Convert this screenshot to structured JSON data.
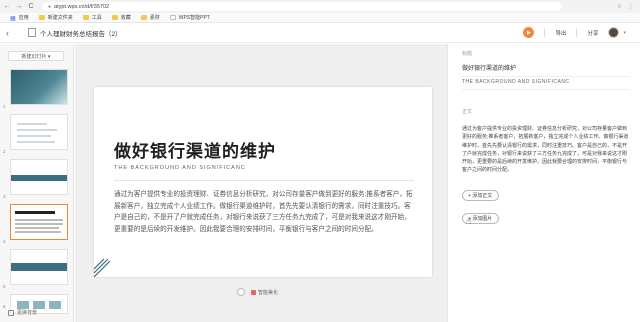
{
  "browser": {
    "url": "atypt.wps.cn/d/f/35702",
    "back": "←",
    "forward": "→",
    "reload": "C",
    "lock": "●",
    "star": "☆",
    "menu": "⋮"
  },
  "bookmarks": [
    {
      "label": "应用",
      "icon": "apps-icon"
    },
    {
      "label": "新建文件夹",
      "icon": "folder-icon"
    },
    {
      "label": "工具",
      "icon": "folder-icon"
    },
    {
      "label": "收藏",
      "icon": "folder-icon"
    },
    {
      "label": "素材",
      "icon": "folder-icon"
    },
    {
      "label": "WPS智能PPT",
      "icon": "doc-icon"
    }
  ],
  "header": {
    "back": "‹",
    "title": "个人理财财务总结报告（2）",
    "play_icon": "▶",
    "export_label": "导出",
    "share_label": "分享",
    "caret": "▾"
  },
  "sidebar": {
    "new_slide_label": "新建幻灯片 ▾",
    "thumbnails": [
      {
        "num": "1"
      },
      {
        "num": "2"
      },
      {
        "num": "3"
      },
      {
        "num": "4"
      },
      {
        "num": "5"
      },
      {
        "num": "6"
      }
    ],
    "active_index": 4,
    "bottom_label": "更换背景"
  },
  "slide": {
    "title": "做好银行渠道的维护",
    "subtitle": "THE BACKGROUND AND SIGNIFICANC",
    "body": "通过为客户提供专业的投资理财、证券信息分析研究，对公司存量客户做到更好的服务;推系者客户，拓展新客户，独立完成个人业绩工作。做银行渠道维护时，首先先要认清银行的需求，同时注重技巧。客户是自己的，不是开了户就完成任务，对银行来说获了三方任务九完成了，可是对我来说这才刚开始，更重要的是后续的开发维护。因此我要合理的安排时间，平衡银行与客户之间的时间分配。"
  },
  "canvas_tools": {
    "tool_label": "智能美化"
  },
  "right_panel": {
    "title_label": "标题",
    "title_value": "做好银行渠道的维护",
    "subtitle_value": "THE BACKGROUND AND SIGNIFICANC",
    "body_label": "正文",
    "body_value": "通过为客户提供专业的投资理财、证券信息分析研究，对公司存量客户做到更好的服务;推系者客户，拓展新客户，独立完成个人业绩工作。做银行渠道维护时，首先先要认清银行的需求，同时注重技巧。客户是自己的，不是开了户就完成任务，对银行来说获了三方任务九完成了，可是对我来说这才刚开始，更重要的是后续的开发维护。因此我要合理的安排时间，平衡银行与客户之间的时间分配。",
    "btn_add_label": "+ 添加正文",
    "btn_add2_label": "+ 添加图片"
  },
  "colors": {
    "accent": "#f0883e",
    "active_thumb": "#e58a3a",
    "theme_teal": "#3b6f7e"
  }
}
